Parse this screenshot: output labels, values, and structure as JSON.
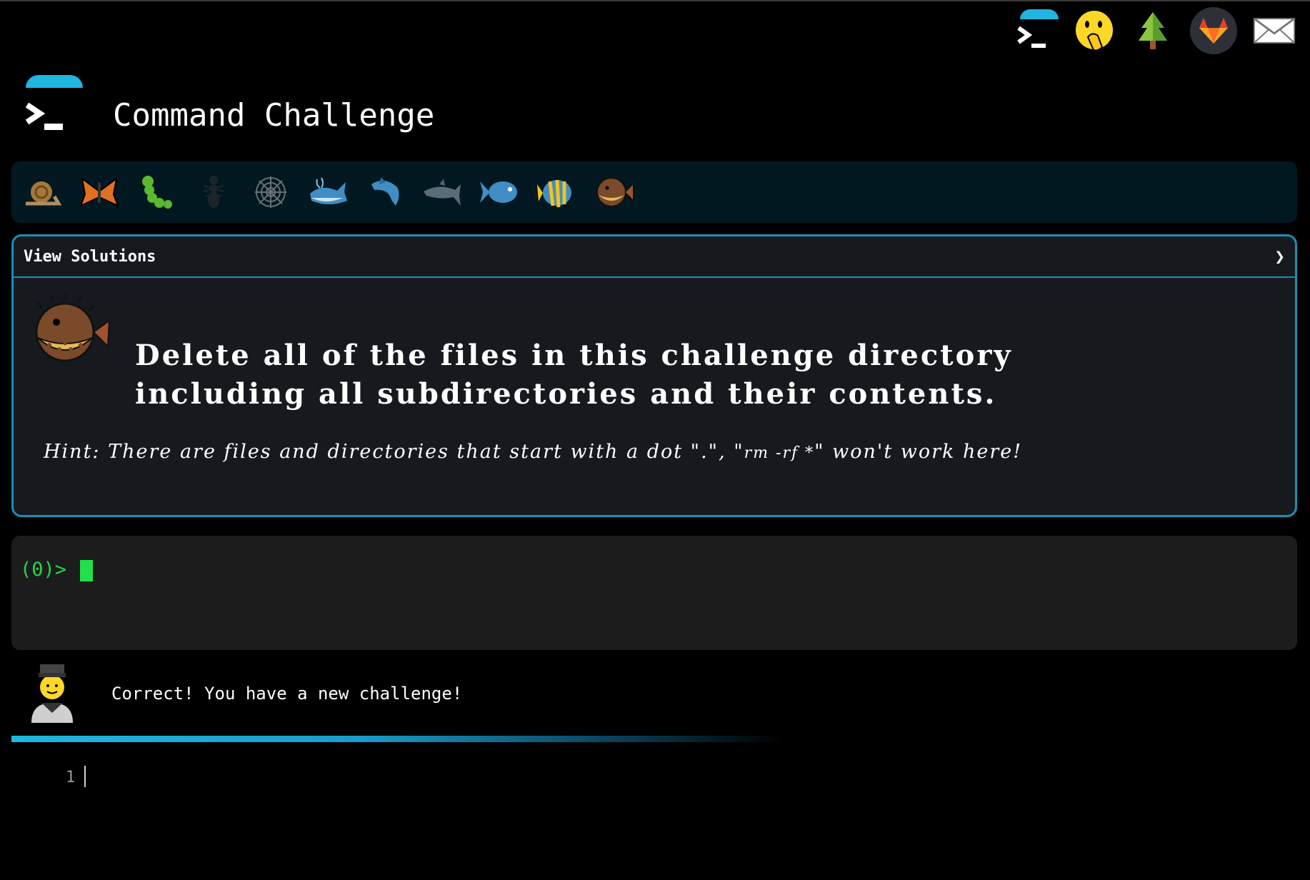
{
  "header": {
    "title": "Command Challenge"
  },
  "top_icons": [
    "terminal-icon",
    "face-with-hand-over-mouth-icon",
    "evergreen-tree-icon",
    "gitlab-icon",
    "envelope-icon"
  ],
  "levels": [
    "snail",
    "butterfly",
    "caterpillar",
    "ant",
    "spider-web",
    "whale",
    "dolphin",
    "dolphin-grey",
    "fish",
    "tropical-fish",
    "blowfish"
  ],
  "panel": {
    "view_solutions": "View Solutions",
    "chevron": "❯",
    "task_line1": "Delete all of the files in this challenge directory",
    "task_line2": "including all subdirectories and their contents.",
    "hint_prefix": "Hint: There are files and directories that start with a dot \".\", \"",
    "hint_code": "rm -rf *",
    "hint_suffix": "\" won't work here!"
  },
  "terminal": {
    "prompt": "(0)>"
  },
  "feedback": {
    "message": "Correct! You have a new challenge!"
  },
  "editor": {
    "line_number": "1"
  },
  "colors": {
    "accent": "#1fb6e0",
    "prompt_green": "#22d44a",
    "panel_border": "#1a8fb5"
  }
}
